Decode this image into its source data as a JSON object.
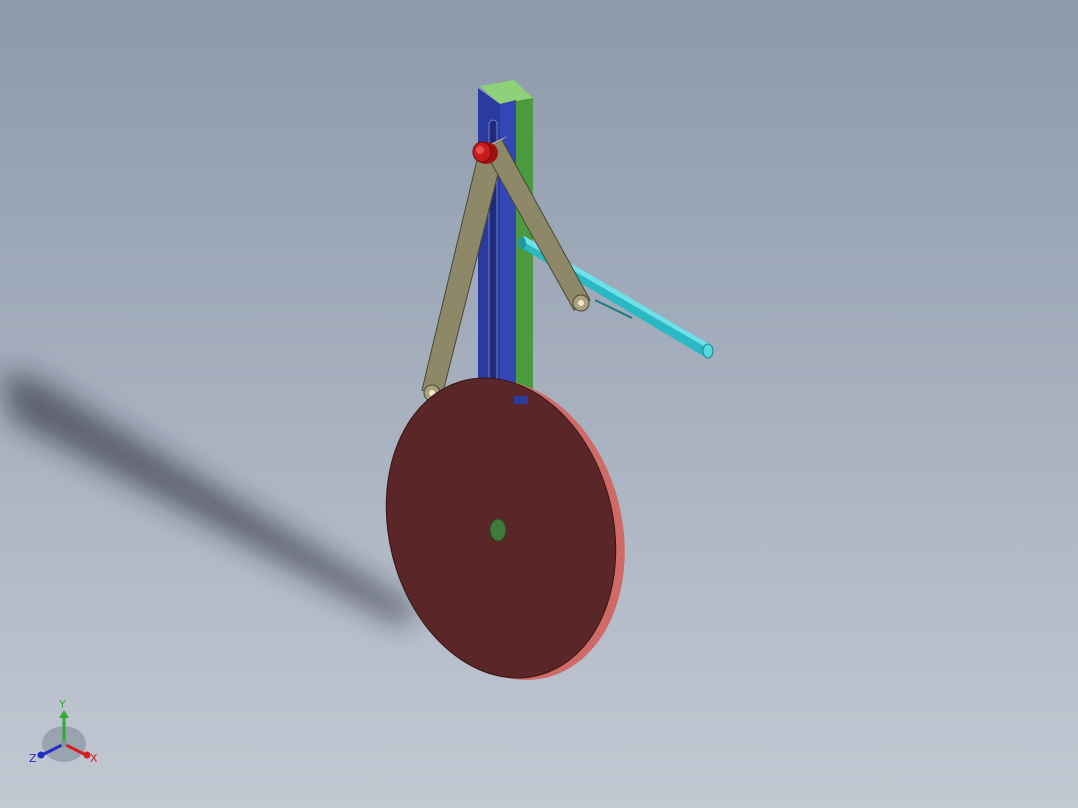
{
  "view": {
    "background_top": "#8d9aac",
    "background_bottom": "#c3c9d3"
  },
  "model": {
    "parts": [
      {
        "name": "guide-frame",
        "color": "#5aa04a"
      },
      {
        "name": "slotted-plate",
        "color": "#2b3a9a"
      },
      {
        "name": "upper-pin",
        "color": "#b01010"
      },
      {
        "name": "long-link",
        "color": "#8f8a6a"
      },
      {
        "name": "short-link",
        "color": "#8f8a6a"
      },
      {
        "name": "push-rod",
        "color": "#27b7c2"
      },
      {
        "name": "crank-disc",
        "color": "#5a2628"
      },
      {
        "name": "disc-hub",
        "color": "#3f7a3a"
      }
    ]
  },
  "triad": {
    "y_label": "Y",
    "x_label": "X",
    "z_label": "Z",
    "y_color": "#2fae2f",
    "x_color": "#d21f1f",
    "z_color": "#1f2fbf"
  }
}
